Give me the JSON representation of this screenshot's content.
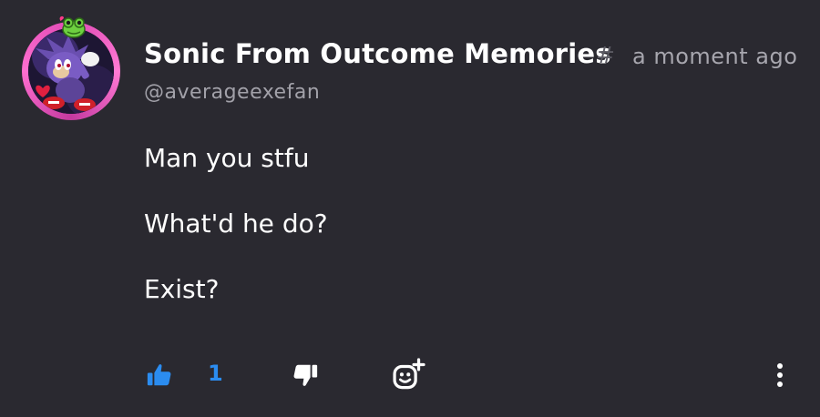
{
  "post": {
    "display_name": "Sonic From Outcome Memories",
    "name_suffix": "#",
    "timestamp": "a moment ago",
    "handle": "@averageexefan",
    "message_lines": [
      "Man you stfu",
      "What'd he do?",
      "Exist?"
    ]
  },
  "actions": {
    "like_count": "1",
    "like_icon": "thumbs-up-icon",
    "dislike_icon": "thumbs-down-icon",
    "react_icon": "add-reaction-icon",
    "more_icon": "more-vertical-icon"
  },
  "colors": {
    "background": "#2a2930",
    "text_primary": "#ffffff",
    "text_secondary": "#a7a6ae",
    "accent_blue": "#2b8cf0",
    "avatar_ring": "#e04ab5"
  }
}
